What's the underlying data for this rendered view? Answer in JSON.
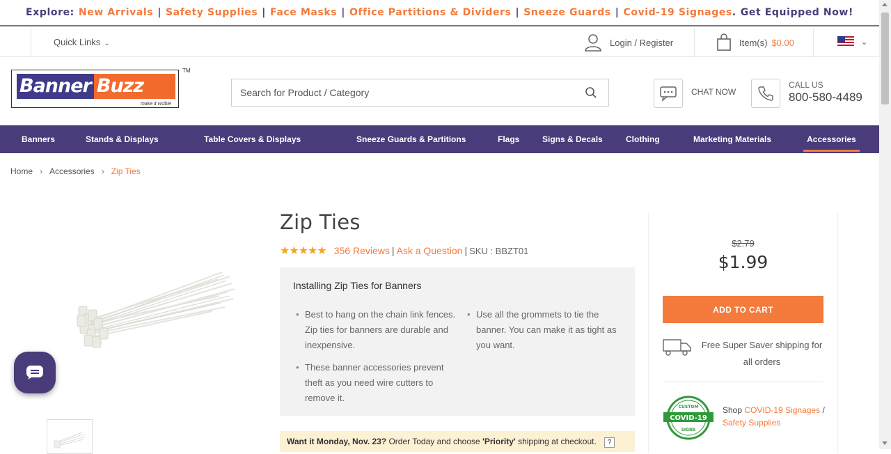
{
  "promo": {
    "prefix": "Explore:",
    "links": [
      "New Arrivals",
      "Safety Supplies",
      "Face Masks",
      "Office Partitions & Dividers",
      "Sneeze Guards",
      "Covid-19 Signages"
    ],
    "suffix": "Get Equipped Now!"
  },
  "util": {
    "quick_links": "Quick Links",
    "login": "Login / Register",
    "cart_label": "Item(s)",
    "cart_amount": "$0.00",
    "country_flag": "us-flag-icon"
  },
  "header": {
    "logo_banner": "Banner",
    "logo_buzz": "Buzz",
    "logo_tagline": "make it visible",
    "logo_tm": "TM",
    "search_placeholder": "Search for Product / Category",
    "chat_label": "CHAT NOW",
    "call_label": "CALL US",
    "phone": "800-580-4489"
  },
  "nav": {
    "items": [
      "Banners",
      "Stands & Displays",
      "Table Covers & Displays",
      "Sneeze Guards & Partitions",
      "Flags",
      "Signs & Decals",
      "Clothing",
      "Marketing Materials",
      "Accessories"
    ],
    "active": "Accessories"
  },
  "breadcrumb": [
    "Home",
    "Accessories",
    "Zip Ties"
  ],
  "product": {
    "title": "Zip Ties",
    "rating": 4.5,
    "stars": "★★★★★",
    "reviews": "356 Reviews",
    "ask": "Ask a Question",
    "sku": "SKU : BBZT01",
    "info_heading": "Installing Zip Ties for Banners",
    "bullets_left": [
      "Best to hang on the chain link fences. Zip ties for banners are durable and inexpensive.",
      "These banner accessories prevent theft as you need wire cutters to remove it."
    ],
    "bullets_right": [
      "Use all the grommets to tie the banner. You can make it as tight as you want."
    ],
    "delivery_bold": "Want it Monday, Nov. 23?",
    "delivery_mid": "Order Today and choose",
    "delivery_priority": "'Priority'",
    "delivery_end": "shipping at checkout.",
    "delivery_help": "?"
  },
  "pricing": {
    "old_price": "$2.79",
    "price": "$1.99",
    "add_to_cart": "ADD TO CART",
    "shipping": "Free Super Saver shipping for all orders",
    "shop": "Shop",
    "covid_link": "COVID-19 Signages",
    "sep": "/",
    "safety_link": "Safety Supplies",
    "badge_top": "CUSTOM",
    "badge_mid": "COVID-19",
    "badge_bottom": "SIGNS"
  },
  "colors": {
    "purple": "#4a3b7a",
    "orange": "#f47b3c",
    "star": "#f5a623",
    "green": "#2e9a3a"
  }
}
